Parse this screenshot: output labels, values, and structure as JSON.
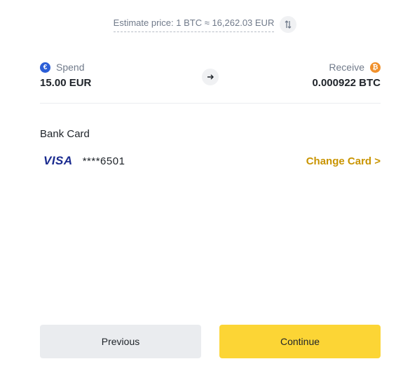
{
  "estimate": {
    "text": "Estimate price: 1 BTC ≈ 16,262.03 EUR",
    "swap_icon": "swap-vertical-icon"
  },
  "spend": {
    "label": "Spend",
    "amount": "15.00 EUR",
    "coin_icon": "euro-coin-icon",
    "coin_glyph": "€",
    "color": "#2b5ed7"
  },
  "receive": {
    "label": "Receive",
    "amount": "0.000922 BTC",
    "coin_icon": "bitcoin-coin-icon",
    "coin_glyph": "₿",
    "color": "#f0902b"
  },
  "arrow_icon": "arrow-right-icon",
  "payment": {
    "section_title": "Bank Card",
    "card_brand": "VISA",
    "card_number": "****6501",
    "change_label": "Change Card >"
  },
  "buttons": {
    "previous_label": "Previous",
    "continue_label": "Continue"
  },
  "colors": {
    "accent": "#fcd535",
    "link": "#c99400",
    "secondary_button": "#eaecef"
  }
}
